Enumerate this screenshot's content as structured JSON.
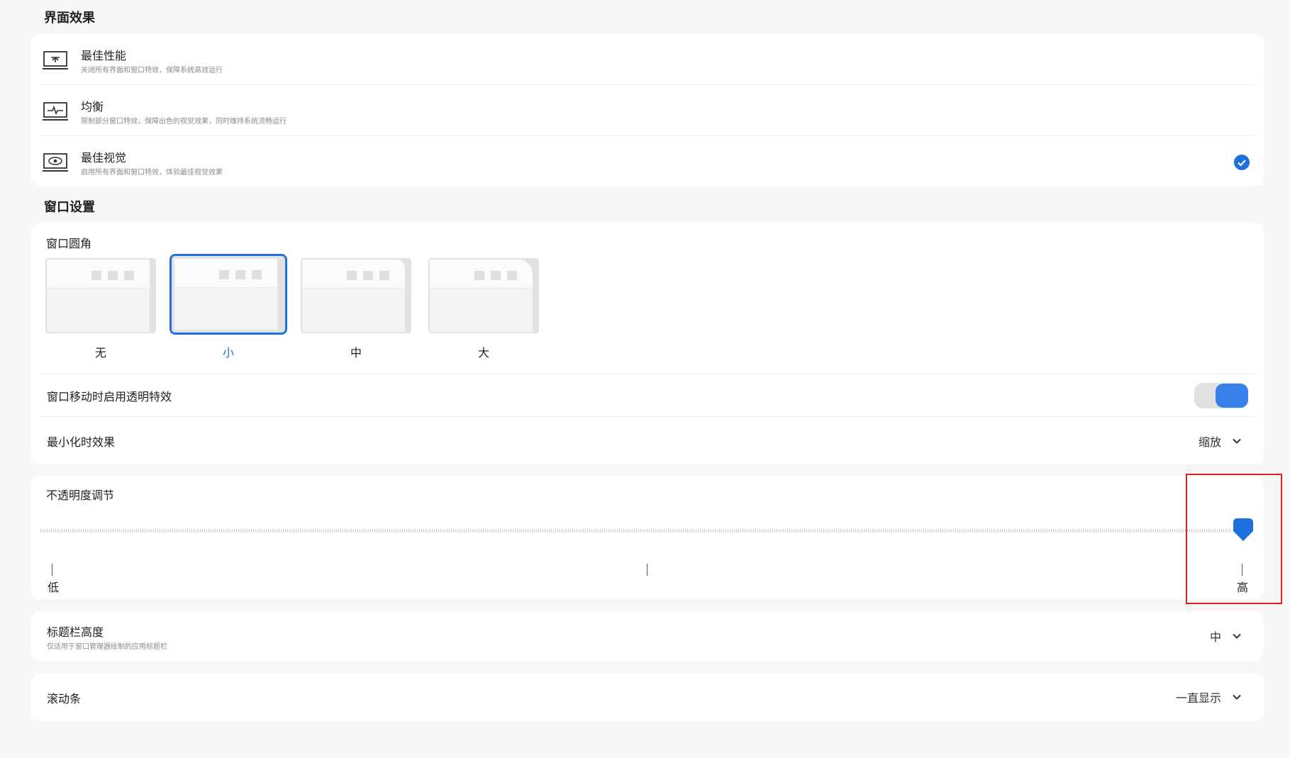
{
  "sections": {
    "interface_effects": "界面效果",
    "window_settings": "窗口设置"
  },
  "effects": [
    {
      "name": "最佳性能",
      "desc": "关闭所有界面和窗口特效，保障系统高效运行",
      "icon": "monitor-performance-icon",
      "selected": false
    },
    {
      "name": "均衡",
      "desc": "限制部分窗口特效，保障出色的视觉效果，同时维持系统流畅运行",
      "icon": "monitor-pulse-icon",
      "selected": false
    },
    {
      "name": "最佳视觉",
      "desc": "启用所有界面和窗口特效，体验最佳视觉效果",
      "icon": "monitor-eye-icon",
      "selected": true
    }
  ],
  "corner": {
    "label": "窗口圆角",
    "options": [
      {
        "label": "无",
        "selected": false
      },
      {
        "label": "小",
        "selected": true
      },
      {
        "label": "中",
        "selected": false
      },
      {
        "label": "大",
        "selected": false
      }
    ]
  },
  "transparency_move": {
    "label": "窗口移动时启用透明特效",
    "enabled": true
  },
  "minimize": {
    "label": "最小化时效果",
    "value": "缩放"
  },
  "opacity": {
    "label": "不透明度调节",
    "low": "低",
    "high": "高",
    "value_percent": 100
  },
  "titlebar": {
    "label": "标题栏高度",
    "desc": "仅适用于窗口管理器绘制的应用标题栏",
    "value": "中"
  },
  "scrollbar": {
    "label": "滚动条",
    "value": "一直显示"
  },
  "colors": {
    "accent": "#1f6fe0",
    "highlight": "#e02020"
  }
}
